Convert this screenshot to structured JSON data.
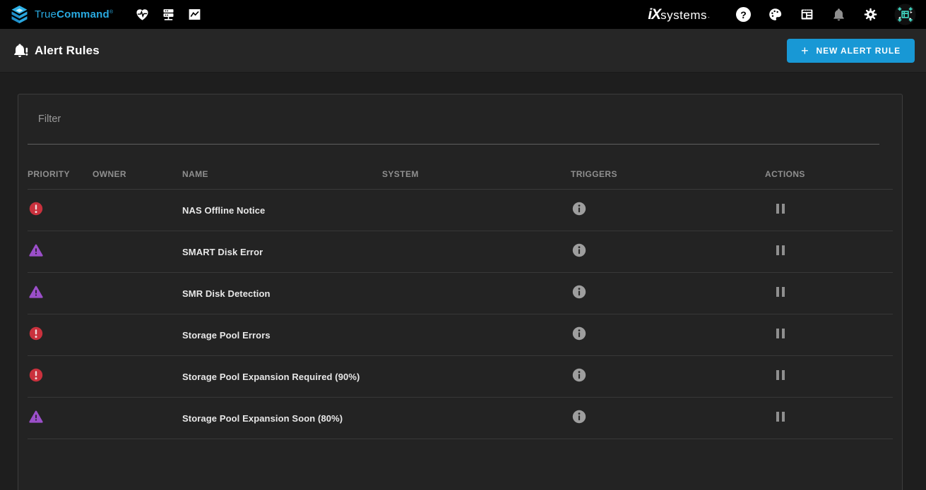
{
  "navbar": {
    "brand": {
      "name_light": "True",
      "name_bold": "Command",
      "trademark": "®"
    },
    "nav_icons": [
      "health-dashboard",
      "systems",
      "reports"
    ],
    "ix": {
      "mark": "iX",
      "text": "systems",
      "trademark": "·"
    },
    "right_icons": [
      "help",
      "theme-palette",
      "widgets",
      "notifications",
      "settings",
      "user-avatar"
    ]
  },
  "icons": {
    "help_glyph": "?",
    "plus_glyph": "+"
  },
  "page_header": {
    "title": "Alert Rules",
    "new_rule_button": "NEW ALERT RULE"
  },
  "filter": {
    "label": "Filter"
  },
  "table": {
    "columns": {
      "priority": "PRIORITY",
      "owner": "OWNER",
      "name": "NAME",
      "system": "SYSTEM",
      "triggers": "TRIGGERS",
      "actions": "ACTIONS"
    },
    "rows": [
      {
        "priority": "error",
        "owner": "",
        "name": "NAS Offline Notice",
        "system": "",
        "triggers": "info",
        "actions": "pause"
      },
      {
        "priority": "warning",
        "owner": "",
        "name": "SMART Disk Error",
        "system": "",
        "triggers": "info",
        "actions": "pause"
      },
      {
        "priority": "warning",
        "owner": "",
        "name": "SMR Disk Detection",
        "system": "",
        "triggers": "info",
        "actions": "pause"
      },
      {
        "priority": "error",
        "owner": "",
        "name": "Storage Pool Errors",
        "system": "",
        "triggers": "info",
        "actions": "pause"
      },
      {
        "priority": "error",
        "owner": "",
        "name": "Storage Pool Expansion Required (90%)",
        "system": "",
        "triggers": "info",
        "actions": "pause"
      },
      {
        "priority": "warning",
        "owner": "",
        "name": "Storage Pool Expansion Soon (80%)",
        "system": "",
        "triggers": "info",
        "actions": "pause"
      }
    ]
  },
  "colors": {
    "accent_blue": "#1898d5",
    "brand_cyan": "#29aae1",
    "error_red": "#c9313d",
    "warning_purple": "#9b4fc9",
    "navbar_bg": "#000000",
    "header_bg": "#262626",
    "card_bg": "#232323"
  }
}
